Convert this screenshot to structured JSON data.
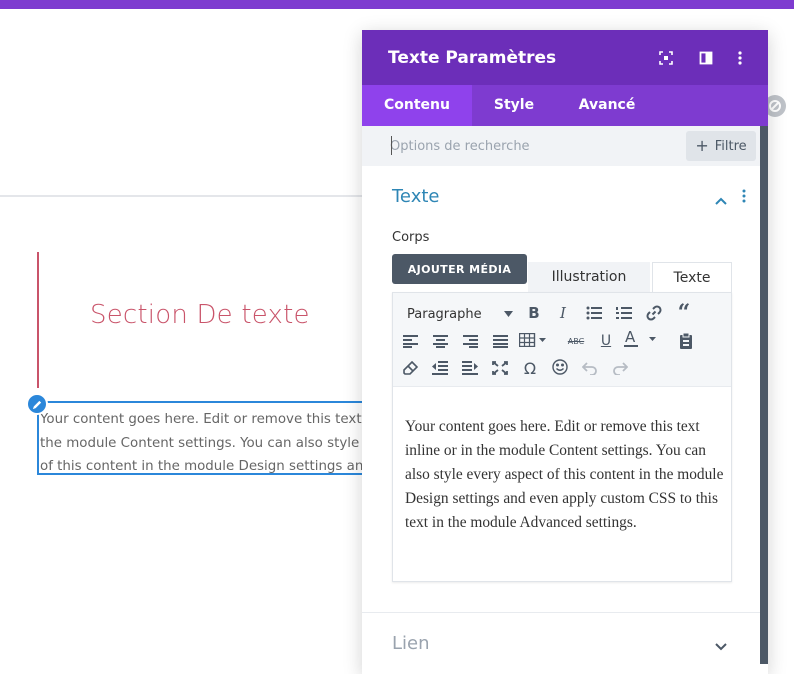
{
  "canvas": {
    "section_title": "Section De texte",
    "body_text": "Your content goes here. Edit or remove this text inline or in the module Content settings. You can also style every aspect of this content in the module Design settings and even apply custom CSS to this text in the module Advanced settings."
  },
  "panel": {
    "title": "Texte Paramètres",
    "tabs": [
      {
        "label": "Contenu",
        "active": true
      },
      {
        "label": "Style",
        "active": false
      },
      {
        "label": "Avancé",
        "active": false
      }
    ],
    "search": {
      "placeholder": "Options de recherche",
      "value": ""
    },
    "filter_label": "Filtre",
    "group_text": {
      "title": "Texte",
      "field_label": "Corps",
      "add_media_label": "AJOUTER MÉDIA",
      "editor_modes": [
        {
          "label": "Illustration",
          "active": false
        },
        {
          "label": "Texte",
          "active": true
        }
      ],
      "format_select": "Paragraphe",
      "editor_content": "Your content goes here. Edit or remove this text inline or in the module Content settings. You can also style every aspect of this content in the module Design settings and even apply custom CSS to this text in the module Advanced settings."
    },
    "group_link": {
      "title": "Lien"
    }
  },
  "colors": {
    "header_purple": "#6c2eb9",
    "tab_purple": "#7e3bd0",
    "active_tab": "#8f42ec",
    "accent_blue": "#2b87da",
    "section_red": "#c9546a",
    "dark_button": "#4c5866"
  },
  "icons": {
    "header": [
      "expand-icon",
      "split-view-icon",
      "more-vertical-icon"
    ],
    "toolbar_row1": [
      "bold-icon",
      "italic-icon",
      "bullet-list-icon",
      "numbered-list-icon",
      "link-icon",
      "blockquote-icon"
    ],
    "toolbar_row2": [
      "align-left-icon",
      "align-center-icon",
      "align-right-icon",
      "align-justify-icon",
      "table-icon",
      "strikethrough-icon",
      "underline-icon",
      "text-color-icon",
      "paste-icon"
    ],
    "toolbar_row3": [
      "clear-format-icon",
      "outdent-icon",
      "indent-icon",
      "fullscreen-icon",
      "omega-icon",
      "emoji-icon",
      "undo-icon",
      "redo-icon"
    ]
  }
}
